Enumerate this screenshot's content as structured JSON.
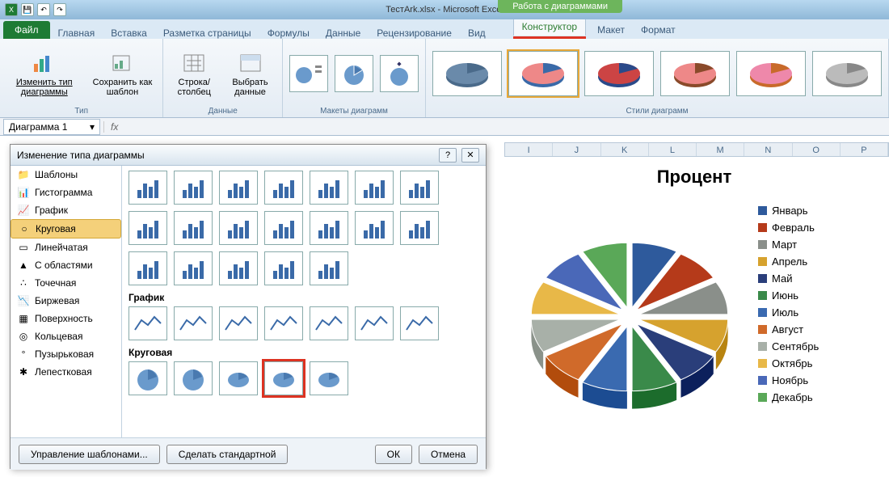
{
  "title": "ТестArk.xlsx - Microsoft Excel",
  "chart_tools_label": "Работа с диаграммами",
  "tabs": {
    "file": "Файл",
    "list": [
      "Главная",
      "Вставка",
      "Разметка страницы",
      "Формулы",
      "Данные",
      "Рецензирование",
      "Вид"
    ],
    "ctx": [
      "Конструктор",
      "Макет",
      "Формат"
    ],
    "active_ctx": 0
  },
  "ribbon": {
    "type_group": "Тип",
    "change_type": "Изменить тип диаграммы",
    "save_template": "Сохранить как шаблон",
    "data_group": "Данные",
    "switch_rc": "Строка/столбец",
    "select_data": "Выбрать данные",
    "layouts_group": "Макеты диаграмм",
    "styles_group": "Стили диаграмм"
  },
  "formula": {
    "namebox": "Диаграмма 1",
    "fx": "fx"
  },
  "columns": [
    "I",
    "J",
    "K",
    "L",
    "M",
    "N",
    "O",
    "P"
  ],
  "dialog": {
    "title": "Изменение типа диаграммы",
    "categories": [
      "Шаблоны",
      "Гистограмма",
      "График",
      "Круговая",
      "Линейчатая",
      "С областями",
      "Точечная",
      "Биржевая",
      "Поверхность",
      "Кольцевая",
      "Пузырьковая",
      "Лепестковая"
    ],
    "selected_cat": 3,
    "section_line": "График",
    "section_pie": "Круговая",
    "manage_templates": "Управление шаблонами...",
    "set_default": "Сделать стандартной",
    "ok": "ОК",
    "cancel": "Отмена"
  },
  "chart_title": "Процент",
  "legend_items": [
    {
      "label": "Январь",
      "color": "#2e5a9c"
    },
    {
      "label": "Февраль",
      "color": "#b53a1a"
    },
    {
      "label": "Март",
      "color": "#8a8f8a"
    },
    {
      "label": "Апрель",
      "color": "#d6a22e"
    },
    {
      "label": "Май",
      "color": "#2a3e7a"
    },
    {
      "label": "Июнь",
      "color": "#3a8a4a"
    },
    {
      "label": "Июль",
      "color": "#3a6ab0"
    },
    {
      "label": "Август",
      "color": "#d06a2a"
    },
    {
      "label": "Сентябрь",
      "color": "#a8b0a8"
    },
    {
      "label": "Октябрь",
      "color": "#e8b848"
    },
    {
      "label": "Ноябрь",
      "color": "#4a68b8"
    },
    {
      "label": "Декабрь",
      "color": "#5aa858"
    }
  ],
  "chart_data": {
    "type": "pie",
    "title": "Процент",
    "categories": [
      "Январь",
      "Февраль",
      "Март",
      "Апрель",
      "Май",
      "Июнь",
      "Июль",
      "Август",
      "Сентябрь",
      "Октябрь",
      "Ноябрь",
      "Декабрь"
    ],
    "values": [
      8.33,
      8.33,
      8.33,
      8.33,
      8.33,
      8.33,
      8.33,
      8.33,
      8.33,
      8.33,
      8.33,
      8.33
    ],
    "colors": [
      "#2e5a9c",
      "#b53a1a",
      "#8a8f8a",
      "#d6a22e",
      "#2a3e7a",
      "#3a8a4a",
      "#3a6ab0",
      "#d06a2a",
      "#a8b0a8",
      "#e8b848",
      "#4a68b8",
      "#5aa858"
    ]
  }
}
